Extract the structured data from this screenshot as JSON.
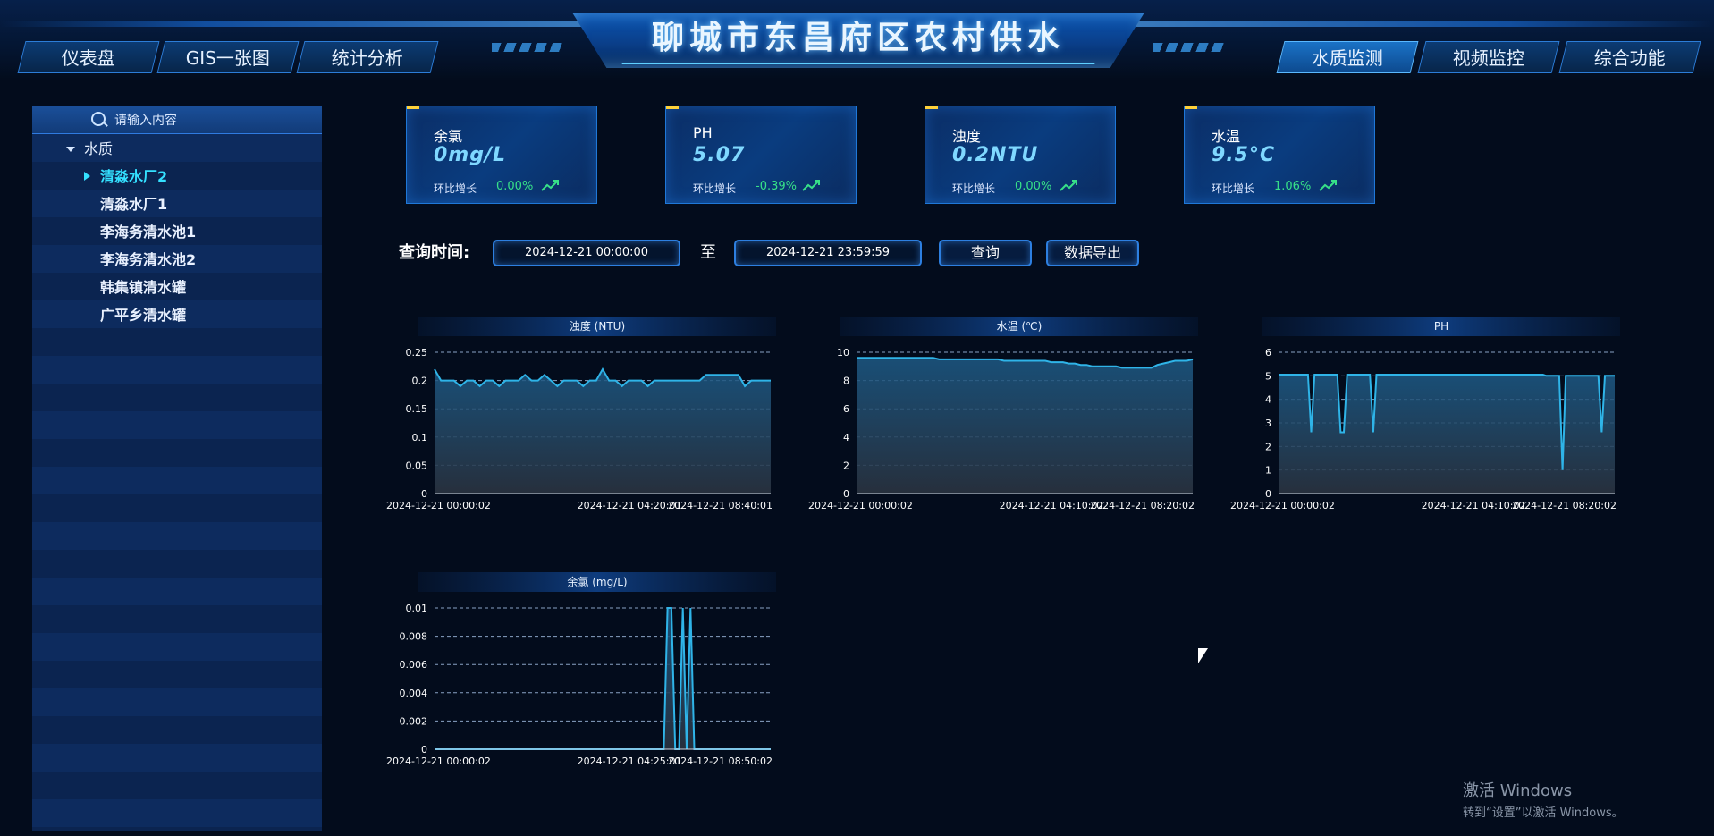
{
  "header": {
    "title": "聊城市东昌府区农村供水",
    "left_tabs": [
      {
        "label": "仪表盘"
      },
      {
        "label": "GIS一张图"
      },
      {
        "label": "统计分析"
      }
    ],
    "right_tabs": [
      {
        "label": "水质监测",
        "active": true
      },
      {
        "label": "视频监控"
      },
      {
        "label": "综合功能"
      }
    ]
  },
  "sidebar": {
    "search_placeholder": "请输入内容",
    "root_label": "水质",
    "items": [
      {
        "label": "清淼水厂2",
        "selected": true
      },
      {
        "label": "清淼水厂1"
      },
      {
        "label": "李海务清水池1"
      },
      {
        "label": "李海务清水池2"
      },
      {
        "label": "韩集镇清水罐"
      },
      {
        "label": "广平乡清水罐"
      }
    ]
  },
  "metrics": [
    {
      "label": "余氯",
      "value": "0mg/L",
      "trend_label": "环比增长",
      "trend_value": "0.00%"
    },
    {
      "label": "PH",
      "value": "5.07",
      "trend_label": "环比增长",
      "trend_value": "-0.39%"
    },
    {
      "label": "浊度",
      "value": "0.2NTU",
      "trend_label": "环比增长",
      "trend_value": "0.00%"
    },
    {
      "label": "水温",
      "value": "9.5°C",
      "trend_label": "环比增长",
      "trend_value": "1.06%"
    }
  ],
  "query": {
    "label": "查询时间:",
    "start": "2024-12-21 00:00:00",
    "to_label": "至",
    "end": "2024-12-21 23:59:59",
    "search_button": "查询",
    "export_button": "数据导出"
  },
  "colors": {
    "accent": "#2fb4e8",
    "trend_up": "#37e088",
    "selected_item": "#34e0ff"
  },
  "chart_data": [
    {
      "type": "area",
      "title": "浊度 (NTU)",
      "ylim": [
        0,
        0.25
      ],
      "yticks": [
        "0.25",
        "0.2",
        "0.15",
        "0.1",
        "0.05",
        "0"
      ],
      "xticks": [
        "2024-12-21 00:00:02",
        "2024-12-21 04:20:01",
        "2024-12-21 08:40:01"
      ],
      "x_range": [
        0,
        1
      ],
      "series": [
        {
          "values": [
            0.22,
            0.2,
            0.2,
            0.2,
            0.19,
            0.2,
            0.2,
            0.19,
            0.2,
            0.2,
            0.19,
            0.2,
            0.2,
            0.2,
            0.21,
            0.2,
            0.2,
            0.21,
            0.2,
            0.19,
            0.2,
            0.2,
            0.2,
            0.19,
            0.2,
            0.2,
            0.22,
            0.2,
            0.2,
            0.19,
            0.2,
            0.2,
            0.2,
            0.19,
            0.2,
            0.2,
            0.2,
            0.2,
            0.2,
            0.2,
            0.2,
            0.2,
            0.21,
            0.21,
            0.21,
            0.21,
            0.21,
            0.21,
            0.19,
            0.2,
            0.2,
            0.2,
            0.2
          ]
        }
      ],
      "grid": true
    },
    {
      "type": "area",
      "title": "水温 (℃)",
      "ylim": [
        0,
        10
      ],
      "yticks": [
        "10",
        "8",
        "6",
        "4",
        "2",
        "0"
      ],
      "xticks": [
        "2024-12-21 00:00:02",
        "2024-12-21 04:10:02",
        "2024-12-21 08:20:02"
      ],
      "series": [
        {
          "values": [
            9.6,
            9.6,
            9.6,
            9.6,
            9.6,
            9.6,
            9.6,
            9.6,
            9.6,
            9.6,
            9.6,
            9.6,
            9.6,
            9.6,
            9.5,
            9.5,
            9.5,
            9.5,
            9.5,
            9.5,
            9.5,
            9.5,
            9.5,
            9.5,
            9.5,
            9.4,
            9.4,
            9.4,
            9.4,
            9.4,
            9.4,
            9.4,
            9.4,
            9.3,
            9.3,
            9.3,
            9.2,
            9.2,
            9.1,
            9.1,
            9.0,
            9.0,
            9.0,
            9.0,
            9.0,
            8.9,
            8.9,
            8.9,
            8.9,
            8.9,
            8.9,
            9.1,
            9.2,
            9.3,
            9.4,
            9.4,
            9.4,
            9.5
          ]
        }
      ],
      "grid": true
    },
    {
      "type": "area",
      "title": "PH",
      "ylim": [
        0,
        6
      ],
      "yticks": [
        "6",
        "5",
        "4",
        "3",
        "2",
        "1",
        "0"
      ],
      "xticks": [
        "2024-12-21 00:00:02",
        "2024-12-21 04:10:02",
        "2024-12-21 08:20:02"
      ],
      "series": [
        {
          "values": [
            5.05,
            5.05,
            5.05,
            5.05,
            5.05,
            5.05,
            5.05,
            5.05,
            5.05,
            5.05,
            2.6,
            5.05,
            5.05,
            5.05,
            5.05,
            5.05,
            5.05,
            5.05,
            5.05,
            2.6,
            2.6,
            5.05,
            5.05,
            5.05,
            5.05,
            5.05,
            5.05,
            5.05,
            5.05,
            2.6,
            5.05,
            5.05,
            5.05,
            5.05,
            5.05,
            5.05,
            5.05,
            5.05,
            5.05,
            5.05,
            5.05,
            5.05,
            5.05,
            5.05,
            5.05,
            5.05,
            5.05,
            5.05,
            5.05,
            5.05,
            5.05,
            5.05,
            5.05,
            5.05,
            5.05,
            5.05,
            5.05,
            5.05,
            5.05,
            5.05,
            5.05,
            5.05,
            5.05,
            5.05,
            5.05,
            5.05,
            5.05,
            5.05,
            5.05,
            5.05,
            5.05,
            5.05,
            5.05,
            5.05,
            5.05,
            5.05,
            5.05,
            5.05,
            5.05,
            5.05,
            5.05,
            5.05,
            5.0,
            5.0,
            5.0,
            5.0,
            5.0,
            1.0,
            5.0,
            5.0,
            5.0,
            5.0,
            5.0,
            5.0,
            5.0,
            5.0,
            5.0,
            5.0,
            5.0,
            2.6,
            5.0,
            5.0,
            5.0,
            5.0
          ]
        }
      ],
      "grid": true
    },
    {
      "type": "area",
      "title": "余氯 (mg/L)",
      "ylim": [
        0,
        0.01
      ],
      "yticks": [
        "0.01",
        "0.008",
        "0.006",
        "0.004",
        "0.002",
        "0"
      ],
      "xticks": [
        "2024-12-21 00:00:02",
        "2024-12-21 04:25:01",
        "2024-12-21 08:50:02"
      ],
      "series": [
        {
          "values": [
            0,
            0,
            0,
            0,
            0,
            0,
            0,
            0,
            0,
            0,
            0,
            0,
            0,
            0,
            0,
            0,
            0,
            0,
            0,
            0,
            0,
            0,
            0,
            0,
            0,
            0,
            0,
            0,
            0,
            0,
            0,
            0,
            0,
            0,
            0,
            0,
            0,
            0,
            0,
            0,
            0,
            0,
            0,
            0,
            0,
            0,
            0,
            0,
            0,
            0,
            0,
            0,
            0,
            0,
            0,
            0,
            0,
            0,
            0,
            0,
            0,
            0.01,
            0.01,
            0,
            0,
            0.01,
            0,
            0.01,
            0,
            0,
            0,
            0,
            0,
            0,
            0,
            0,
            0,
            0,
            0,
            0,
            0,
            0,
            0,
            0,
            0,
            0,
            0,
            0,
            0
          ]
        }
      ],
      "grid": true
    }
  ],
  "watermark": {
    "line1": "激活 Windows",
    "line2": "转到“设置”以激活 Windows。"
  }
}
